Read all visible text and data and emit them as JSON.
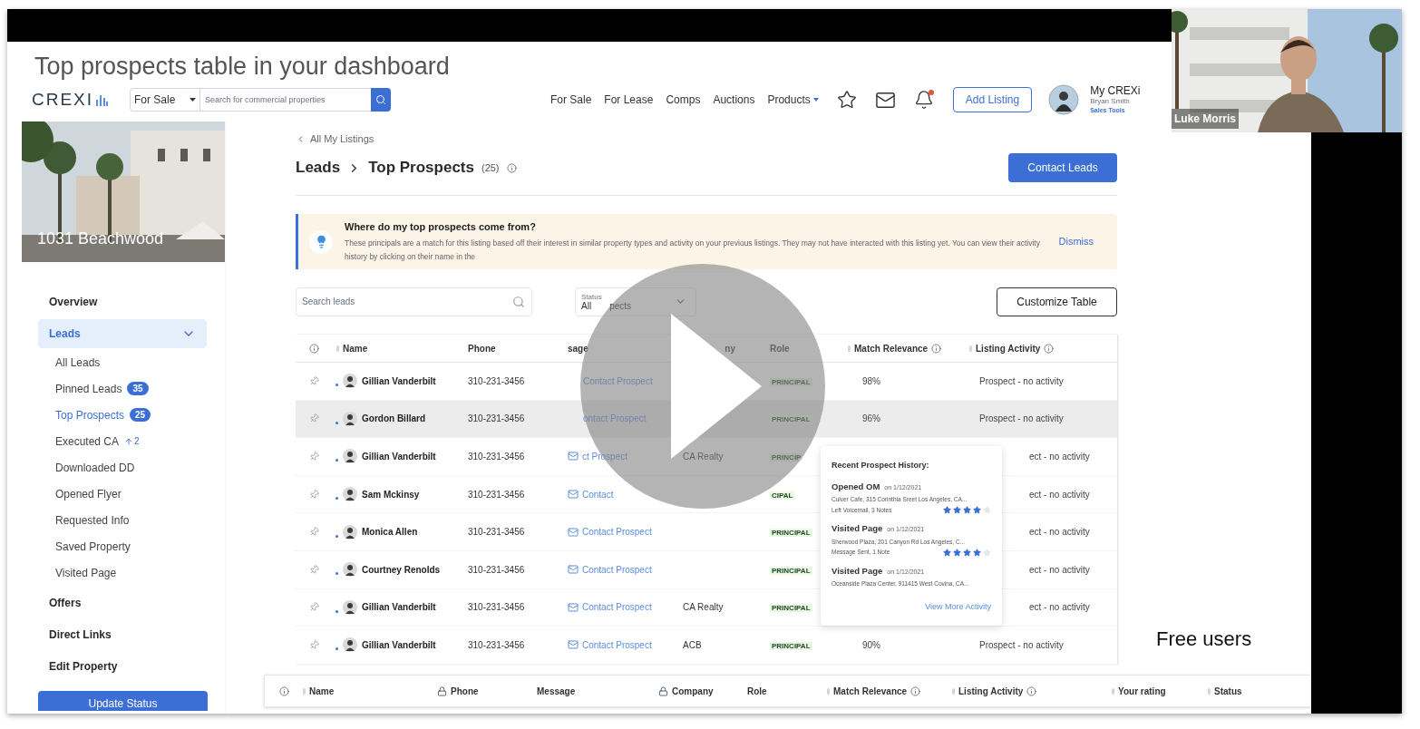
{
  "slide_title": "Top prospects table in your dashboard",
  "header": {
    "logo": "CREXI",
    "market_select": "For Sale",
    "search_placeholder": "Search for commercial properties",
    "nav": [
      "For Sale",
      "For Lease",
      "Comps",
      "Auctions",
      "Products"
    ],
    "notification_unread": true,
    "add_listing": "Add Listing",
    "account": {
      "title": "My CREXi",
      "name": "Bryan Smith",
      "link": "Sales Tools"
    }
  },
  "property": {
    "name": "1031 Beachwood"
  },
  "sidebar": {
    "items": [
      {
        "kind": "section",
        "label": "Overview",
        "selected": false
      },
      {
        "kind": "section",
        "label": "Leads",
        "selected": true,
        "expanded": true,
        "children": [
          {
            "label": "All Leads",
            "selected": false
          },
          {
            "label": "Pinned Leads",
            "selected": false,
            "count": {
              "kind": "badge",
              "text": "35"
            }
          },
          {
            "label": "Top Prospects",
            "selected": true,
            "count": {
              "kind": "badge",
              "text": "25"
            }
          },
          {
            "label": "Executed CA",
            "selected": false,
            "count": {
              "kind": "trend",
              "text": "2"
            }
          },
          {
            "label": "Downloaded DD",
            "selected": false
          },
          {
            "label": "Opened Flyer",
            "selected": false
          },
          {
            "label": "Requested Info",
            "selected": false
          },
          {
            "label": "Saved Property",
            "selected": false
          },
          {
            "label": "Visited Page",
            "selected": false
          }
        ]
      },
      {
        "kind": "section",
        "label": "Offers",
        "selected": false
      },
      {
        "kind": "section",
        "label": "Direct Links",
        "selected": false
      },
      {
        "kind": "section",
        "label": "Edit Property",
        "selected": false
      }
    ],
    "button": "Update Status"
  },
  "back_link": "All My Listings",
  "page_heading": {
    "section": "Leads",
    "title": "Top Prospects",
    "count": "(25)"
  },
  "contact_button": "Contact Leads",
  "notice": {
    "title": "Where do my top prospects come from?",
    "body": "These principals are a match for this listing based off their interest in similar property types and activity on your previous listings. They may not have interacted with this listing yet. You can view their activity history by clicking on their name in the",
    "dismiss": "Dismiss"
  },
  "lead_search": {
    "placeholder": "Search leads"
  },
  "status_filter": {
    "label": "Status",
    "value": "All",
    "value_fragment": "pects"
  },
  "customize_button": "Customize Table",
  "table": {
    "columns": [
      {
        "label": "Name",
        "sortable": true
      },
      {
        "label": "Phone",
        "sortable": false
      },
      {
        "label": "sage",
        "sortable": false
      },
      {
        "label": "ny",
        "sortable": false
      },
      {
        "label": "Role",
        "sortable": false
      },
      {
        "label": "Match Relevance",
        "sortable": true,
        "info": true
      },
      {
        "label": "Listing Activity",
        "sortable": true,
        "info": true
      }
    ],
    "rows": [
      {
        "selected": false,
        "unread": true,
        "name": "Gillian Vanderbilt",
        "phone": "310-231-3456",
        "message": "Contact Prospect",
        "mail_icon": false,
        "role": "PRINCIPAL",
        "match": "98%",
        "activity": "Prospect - no activity"
      },
      {
        "selected": true,
        "unread": true,
        "name": "Gordon Billard",
        "phone": "310-231-3456",
        "message": "ontact Prospect",
        "mail_icon": false,
        "role": "PRINCIPAL",
        "match": "96%",
        "activity": "Prospect - no activity"
      },
      {
        "selected": false,
        "unread": true,
        "name": "Gillian Vanderbilt",
        "phone": "310-231-3456",
        "message": "ct Prospect",
        "mail_icon": true,
        "company": "CA Realty",
        "role": "PRINCIP",
        "activity": "ect - no activity"
      },
      {
        "selected": false,
        "unread": true,
        "name": "Sam Mckinsy",
        "phone": "310-231-3456",
        "message": "Contact",
        "mail_icon": true,
        "role": "CIPAL",
        "activity": "ect - no activity"
      },
      {
        "selected": false,
        "unread": true,
        "name": "Monica Allen",
        "phone": "310-231-3456",
        "message": "Contact Prospect",
        "mail_icon": true,
        "role": "PRINCIPAL",
        "activity": "ect - no activity"
      },
      {
        "selected": false,
        "unread": true,
        "name": "Courtney Renolds",
        "phone": "310-231-3456",
        "message": "Contact Prospect",
        "mail_icon": true,
        "role": "PRINCIPAL",
        "activity": "ect - no activity"
      },
      {
        "selected": false,
        "unread": true,
        "name": "Gillian Vanderbilt",
        "phone": "310-231-3456",
        "message": "Contact Prospect",
        "mail_icon": true,
        "company": "CA Realty",
        "role": "PRINCIPAL",
        "activity": "ect - no activity"
      },
      {
        "selected": false,
        "unread": true,
        "name": "Gillian Vanderbilt",
        "phone": "310-231-3456",
        "message": "Contact Prospect",
        "mail_icon": true,
        "company": "ACB",
        "role": "PRINCIPAL",
        "match": "90%",
        "activity": "Prospect - no activity"
      }
    ]
  },
  "popover": {
    "title": "Recent Prospect History:",
    "events": [
      {
        "action": "Opened OM",
        "date": "on 1/12/2021",
        "place": "Culver Cafe, 315 Corinthia Sreet Los Angeles, CA...",
        "note": "Left Voicemail, 3 Notes",
        "stars": 4
      },
      {
        "action": "Visited Page",
        "date": "on 1/12/2021",
        "place": "Sherwood Plaza, 201 Canyon Rd Los Angeles, C...",
        "note": "Message Sent, 1 Note",
        "stars": 4
      },
      {
        "action": "Visited Page",
        "date": "on 1/12/2021",
        "place": "Oceanside Plaza Center, 911415 West Covina, CA..."
      }
    ],
    "link": "View More Activity"
  },
  "lower_table": {
    "columns": [
      {
        "label": "Name",
        "sortable": true
      },
      {
        "label": "Phone",
        "locked": true
      },
      {
        "label": "Message"
      },
      {
        "label": "Company",
        "locked": true
      },
      {
        "label": "Role"
      },
      {
        "label": "Match Relevance",
        "sortable": true,
        "info": true
      },
      {
        "label": "Listing Activity",
        "sortable": true,
        "info": true
      },
      {
        "label": "Your rating",
        "sortable": true
      },
      {
        "label": "Status",
        "sortable": true
      }
    ]
  },
  "caption": "Free users",
  "webcam": {
    "name": "Luke Morris"
  }
}
